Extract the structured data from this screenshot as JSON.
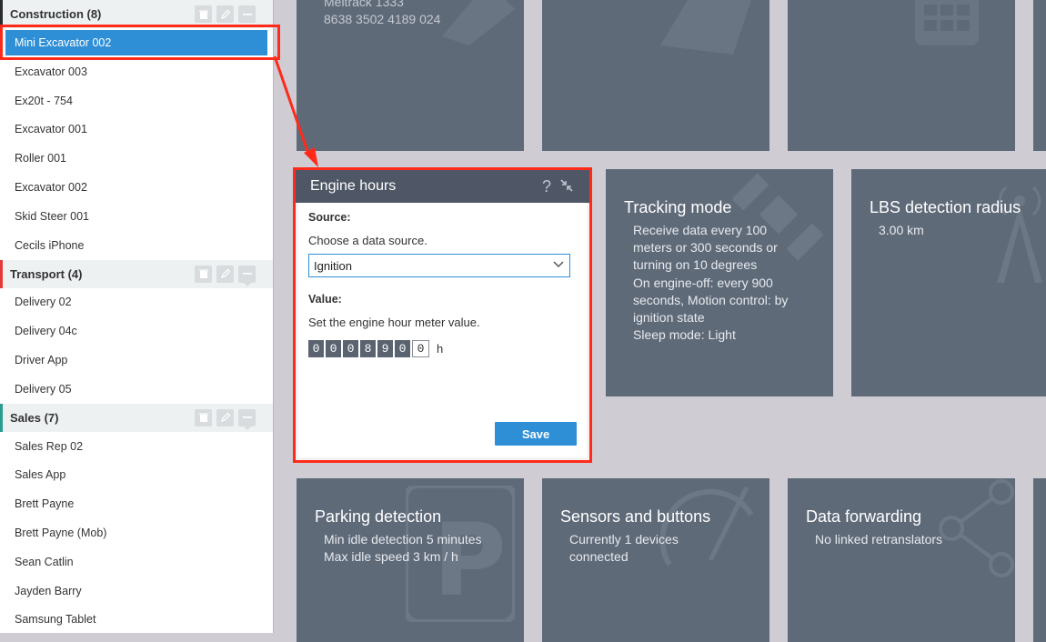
{
  "sidebar": {
    "groups": [
      {
        "title": "Construction (8)",
        "color": "#2b2b2b",
        "units": [
          "Mini Excavator 002",
          "Excavator 003",
          "Ex20t - 754",
          "Excavator 001",
          "Roller 001",
          "Excavator 002",
          "Skid Steer 001",
          "Cecils iPhone"
        ]
      },
      {
        "title": "Transport (4)",
        "color": "#e53a3a",
        "units": [
          "Delivery 02",
          "Delivery 04c",
          "Driver App",
          "Delivery 05"
        ]
      },
      {
        "title": "Sales (7)",
        "color": "#2a9d8f",
        "units": [
          "Sales Rep 02",
          "Sales App",
          "Brett Payne",
          "Brett Payne (Mob)",
          "Sean Catlin",
          "Jayden Barry",
          "Samsung Tablet"
        ]
      }
    ],
    "selected_unit": "Mini Excavator 002"
  },
  "top_tile": {
    "line1": "Meitrack 1333",
    "line2": "8638 3502 4189 024"
  },
  "tiles": {
    "tracking": {
      "title": "Tracking mode",
      "lines": [
        "Receive data every 100",
        "meters or 300 seconds or",
        "turning on 10 degrees",
        "On engine-off: every 900",
        "seconds, Motion control: by",
        "ignition state",
        "Sleep mode: Light"
      ]
    },
    "lbs": {
      "title": "LBS detection radius",
      "lines": [
        "3.00 km"
      ]
    },
    "parking": {
      "title": "Parking detection",
      "lines": [
        "Min idle detection 5 minutes",
        "Max idle speed 3 km / h"
      ]
    },
    "sensors": {
      "title": "Sensors and buttons",
      "lines": [
        "Currently 1 devices",
        "connected"
      ]
    },
    "forwarding": {
      "title": "Data forwarding",
      "lines": [
        "No linked retranslators"
      ]
    }
  },
  "dialog": {
    "title": "Engine hours",
    "help": "?",
    "source_label": "Source:",
    "source_hint": "Choose a data source.",
    "source_value": "Ignition",
    "value_label": "Value:",
    "value_hint": "Set the engine hour meter value.",
    "digits": [
      "0",
      "0",
      "0",
      "8",
      "9",
      "0",
      "0"
    ],
    "unit": "h",
    "save_label": "Save"
  },
  "colors": {
    "accent": "#2f8fd6",
    "highlight": "#ff2a1a",
    "tile": "#5f6a79"
  }
}
